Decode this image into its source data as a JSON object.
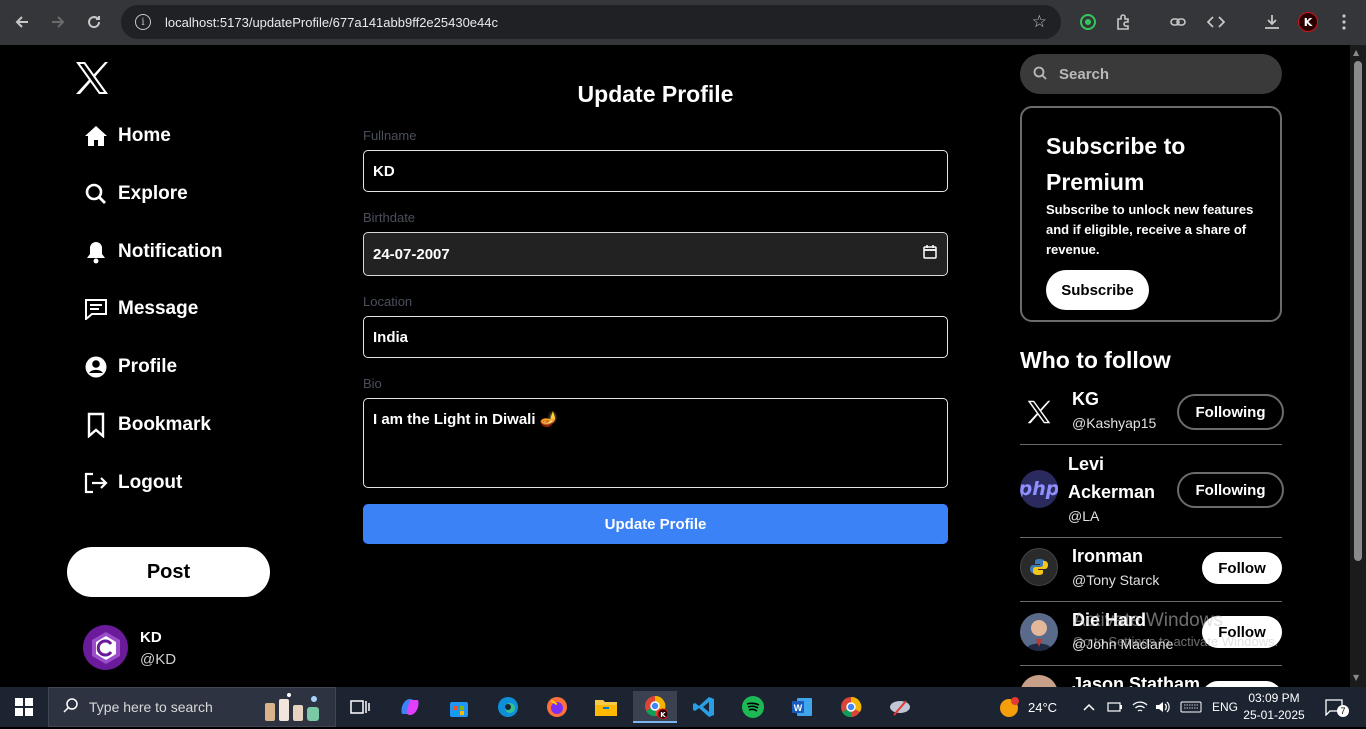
{
  "browser": {
    "url": "localhost:5173/updateProfile/677a141abb9ff2e25430e44c",
    "profile_initial": "K"
  },
  "sidebar": {
    "items": [
      {
        "label": "Home",
        "icon": "home-icon"
      },
      {
        "label": "Explore",
        "icon": "search-icon"
      },
      {
        "label": "Notification",
        "icon": "bell-icon"
      },
      {
        "label": "Message",
        "icon": "message-icon"
      },
      {
        "label": "Profile",
        "icon": "user-icon"
      },
      {
        "label": "Bookmark",
        "icon": "bookmark-icon"
      },
      {
        "label": "Logout",
        "icon": "logout-icon"
      }
    ],
    "post_label": "Post",
    "user": {
      "name": "KD",
      "handle": "@KD"
    }
  },
  "form": {
    "title": "Update Profile",
    "fullname_label": "Fullname",
    "fullname_value": "KD",
    "birthdate_label": "Birthdate",
    "birthdate_value": "24-07-2007",
    "location_label": "Location",
    "location_value": "India",
    "bio_label": "Bio",
    "bio_value": "I am the Light in Diwali 🪔",
    "submit_label": "Update Profile"
  },
  "right": {
    "search_placeholder": "Search",
    "premium": {
      "title": "Subscribe to Premium",
      "text": "Subscribe to unlock new features and if eligible, receive a share of revenue.",
      "button": "Subscribe"
    },
    "who_to_follow_title": "Who to follow",
    "follow": [
      {
        "name": "KG",
        "handle": "@Kashyap15",
        "button": "Following"
      },
      {
        "name": "Levi Ackerman",
        "handle": "@LA",
        "button": "Following"
      },
      {
        "name": "Ironman",
        "handle": "@Tony Starck",
        "button": "Follow"
      },
      {
        "name": "Die Hard",
        "handle": "@John Maclane",
        "button": "Follow"
      },
      {
        "name": "Jason Statham",
        "handle": "",
        "button": ""
      }
    ]
  },
  "watermark": {
    "line1": "Activate Windows",
    "line2": "Go to Settings to activate Windows."
  },
  "taskbar": {
    "search_placeholder": "Type here to search",
    "weather": "24°C",
    "language": "ENG",
    "time": "03:09 PM",
    "date": "25-01-2025",
    "notification_count": "7"
  },
  "colors": {
    "accent_blue": "#3b82f6",
    "background": "#000000",
    "border_gray": "#6b6b6b"
  }
}
